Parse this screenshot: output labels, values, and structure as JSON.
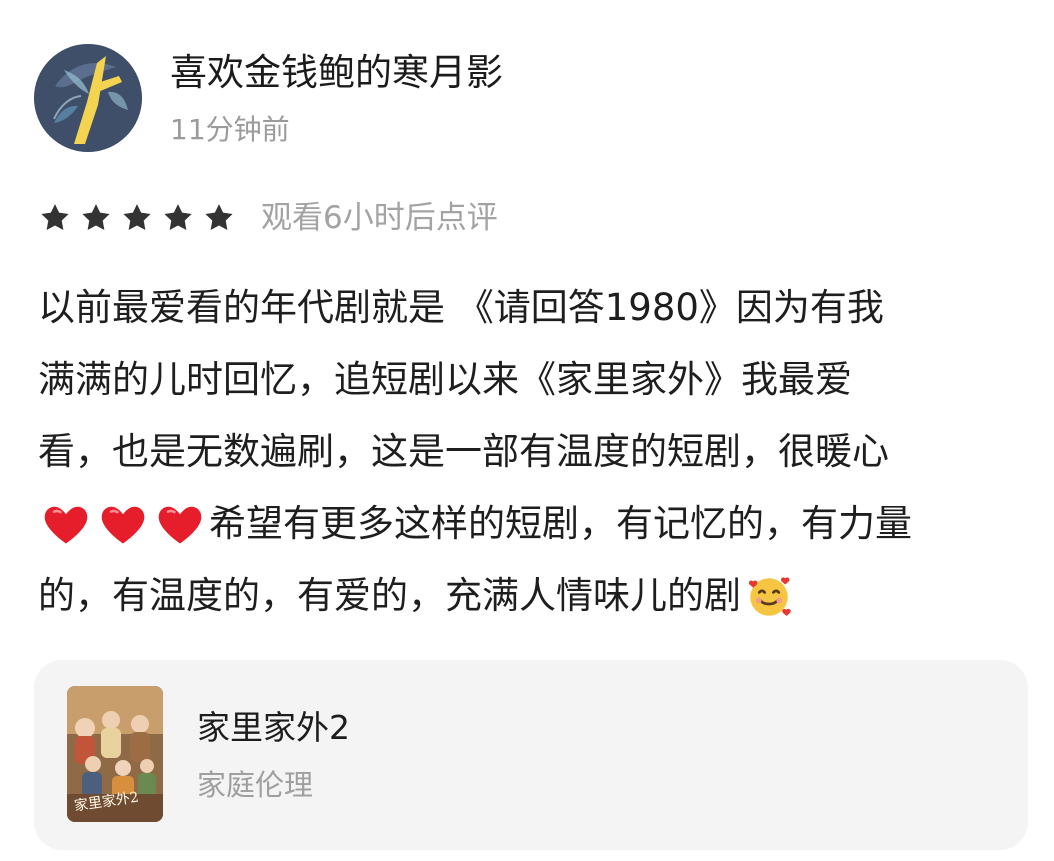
{
  "user": {
    "name": "喜欢金钱鲍的寒月影",
    "time_ago": "11分钟前",
    "avatar": "avatar-icon"
  },
  "rating": {
    "stars": 5,
    "max_stars": 5,
    "note": "观看6小时后点评",
    "star_color": "#333333"
  },
  "review": {
    "line1": "以前最爱看的年代剧就是 《请回答1980》因为有我",
    "line2": "满满的儿时回忆，追短剧以来《家里家外》我最爱",
    "line3": "看，也是无数遍刷，这是一部有温度的短剧，很暖心",
    "line4": "希望有更多这样的短剧，有记忆的，有力量",
    "line5": "的，有温度的，有爱的，充满人情味儿的剧",
    "icons": [
      "heart-emoji",
      "heart-emoji",
      "heart-emoji",
      "smiling-face-with-hearts-emoji"
    ]
  },
  "drama_card": {
    "title": "家里家外2",
    "genre": "家庭伦理",
    "poster_text": "家里家外2",
    "background_color": "#f4f4f4"
  }
}
